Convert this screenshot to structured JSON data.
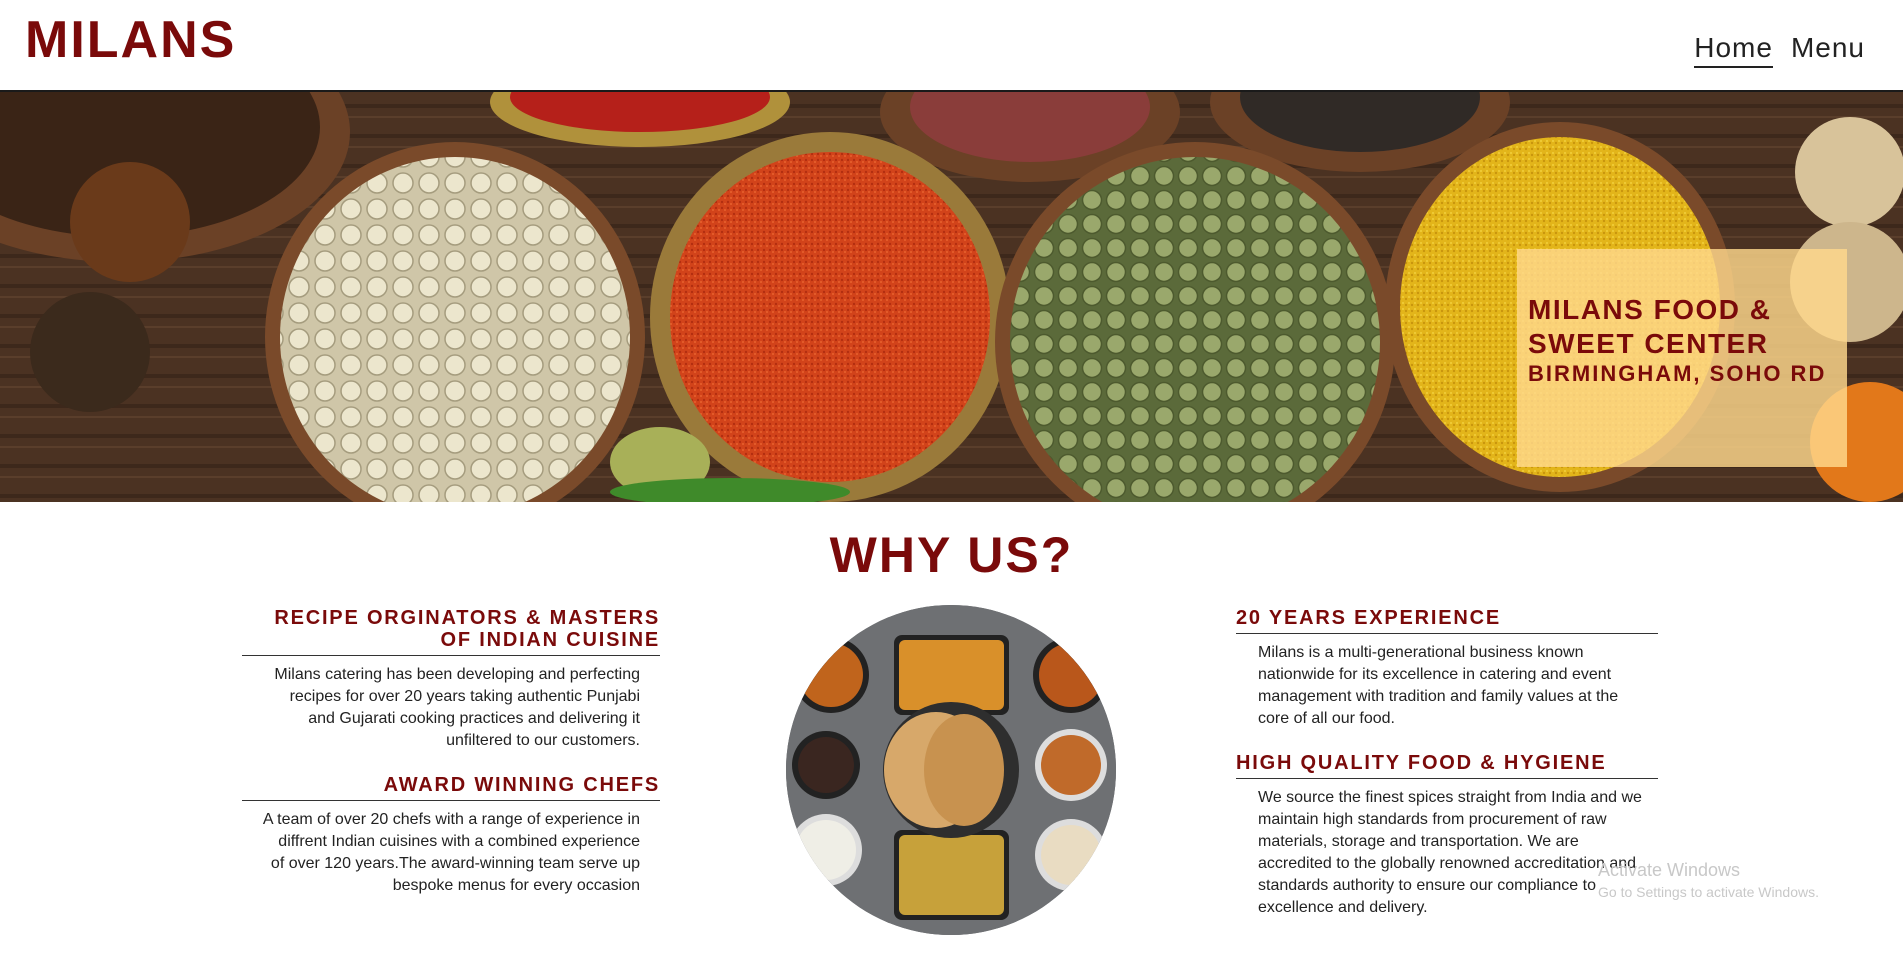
{
  "header": {
    "brand": "MILANS",
    "nav": [
      {
        "label": "Home",
        "active": true
      },
      {
        "label": "Menu",
        "active": false
      }
    ]
  },
  "hero": {
    "title": "MILANS FOOD & SWEET CENTER",
    "subtitle": "BIRMINGHAM, SOHO RD"
  },
  "why": {
    "title": "WHY US?",
    "left": [
      {
        "heading": "RECIPE ORGINATORS & MASTERS OF INDIAN CUISINE",
        "body": "Milans catering has been developing and perfecting recipes for over 20 years taking authentic Punjabi and Gujarati cooking practices and delivering it unfiltered to our customers."
      },
      {
        "heading": "AWARD WINNING CHEFS",
        "body": "A team of over 20 chefs with a range of experience in diffrent Indian cuisines with a combined experience of over 120 years.The award-winning team serve up bespoke menus for every occasion"
      }
    ],
    "right": [
      {
        "heading": "20 YEARS EXPERIENCE",
        "body": "Milans is a multi-generational business known nationwide for its excellence in catering and event management with tradition and family values at the core of all our food."
      },
      {
        "heading": "HIGH QUALITY FOOD & HYGIENE",
        "body": "We source the finest spices straight from India and we maintain high standards from procurement of raw materials, storage and transportation. We are accredited to the globally renowned accreditation and standards authority to ensure our compliance to excellence and delivery."
      }
    ]
  },
  "watermark": {
    "line1": "Activate Windows",
    "line2": "Go to Settings to activate Windows."
  },
  "colors": {
    "brand": "#7a0a0a",
    "hero_box": "#ffd88c"
  }
}
